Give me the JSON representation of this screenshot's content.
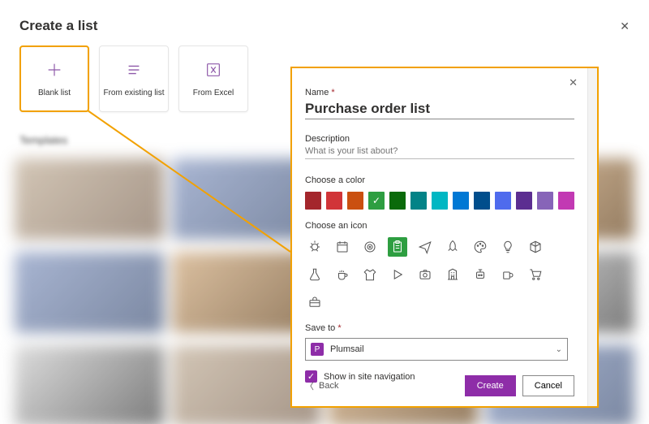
{
  "header": {
    "title": "Create a list"
  },
  "cards": [
    {
      "label": "Blank list",
      "icon": "plus-icon"
    },
    {
      "label": "From existing list",
      "icon": "list-icon"
    },
    {
      "label": "From Excel",
      "icon": "excel-icon"
    },
    {
      "label": "",
      "icon": "template-icon"
    }
  ],
  "section_blur_label": "Templates",
  "panel": {
    "name_label": "Name",
    "name_value": "Purchase order list",
    "desc_label": "Description",
    "desc_placeholder": "What is your list about?",
    "color_label": "Choose a color",
    "colors": [
      "#a4262c",
      "#d13438",
      "#ca5010",
      "#2e9e41",
      "#0b6a0b",
      "#038387",
      "#00b7c3",
      "#0078d4",
      "#004e8c",
      "#4f6bed",
      "#5c2e91",
      "#8764b8",
      "#c239b3"
    ],
    "color_selected_index": 3,
    "icon_label": "Choose an icon",
    "icons": [
      "bug",
      "calendar",
      "target",
      "clipboard",
      "plane",
      "rocket",
      "palette",
      "lightbulb",
      "cube",
      "flask",
      "coffee-cup",
      "shirt",
      "play",
      "camera",
      "building",
      "robot",
      "mug",
      "cart",
      "toolbox"
    ],
    "icon_selected_index": 3,
    "save_label": "Save to",
    "save_value": "Plumsail",
    "save_badge": "P",
    "nav_checkbox_label": "Show in site navigation",
    "nav_checked": true,
    "back_label": "Back",
    "create_label": "Create",
    "cancel_label": "Cancel"
  }
}
